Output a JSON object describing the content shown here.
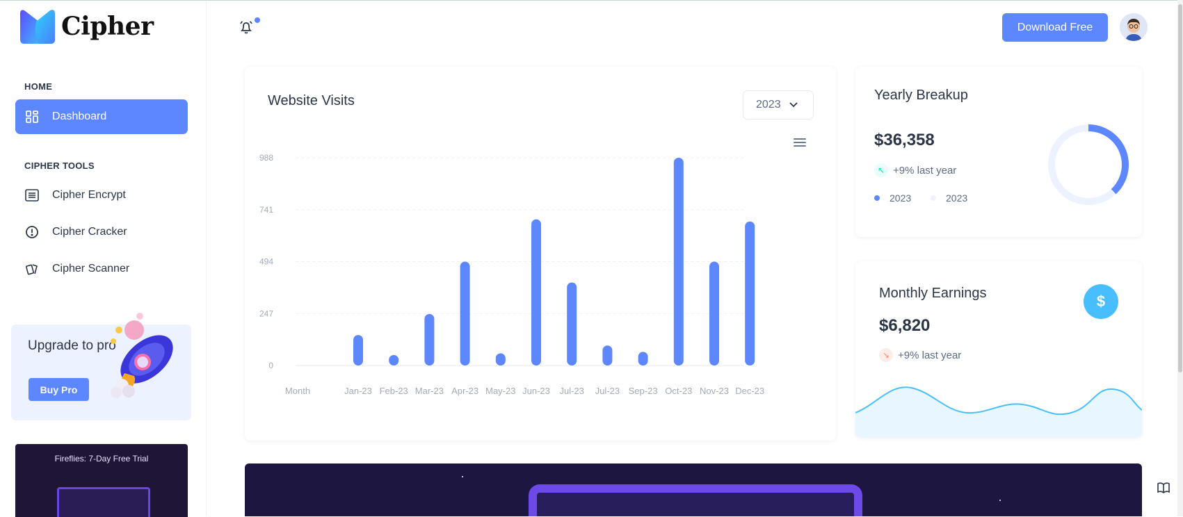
{
  "brand": {
    "name": "Cipher"
  },
  "sidebar": {
    "sections": [
      {
        "label": "HOME",
        "items": [
          {
            "label": "Dashboard",
            "icon": "grid-icon",
            "active": true
          }
        ]
      },
      {
        "label": "CIPHER TOOLS",
        "items": [
          {
            "label": "Cipher Encrypt",
            "icon": "list-icon"
          },
          {
            "label": "Cipher Cracker",
            "icon": "alert-circle-icon"
          },
          {
            "label": "Cipher Scanner",
            "icon": "cards-icon"
          }
        ]
      }
    ],
    "upgrade": {
      "title": "Upgrade to pro",
      "button": "Buy Pro"
    },
    "promo": {
      "text": "Fireflies: 7-Day Free Trial"
    }
  },
  "header": {
    "download_label": "Download Free",
    "notification_icon": "bell-icon"
  },
  "visits": {
    "title": "Website Visits",
    "year_selected": "2023",
    "menu_icon": "hamburger-icon"
  },
  "yearly": {
    "title": "Yearly Breakup",
    "amount": "$36,358",
    "trend": "+9% last year",
    "legend": [
      "2023",
      "2023"
    ],
    "donut_fraction": 0.38,
    "colors": {
      "primary": "#5d87ff",
      "light": "#ecf2ff"
    }
  },
  "monthly": {
    "title": "Monthly Earnings",
    "amount": "$6,820",
    "trend": "+9% last year",
    "icon": "dollar-icon",
    "colors": {
      "line": "#49beff",
      "trend_down": "#fa896b"
    }
  },
  "chart_data": {
    "type": "bar",
    "categories": [
      "Jan-23",
      "Feb-23",
      "Mar-23",
      "Apr-23",
      "May-23",
      "Jun-23",
      "Jul-23",
      "Jul-23",
      "Sep-23",
      "Oct-23",
      "Nov-23",
      "Dec-23"
    ],
    "x_first_label": "Month",
    "values": [
      145,
      50,
      245,
      494,
      58,
      695,
      395,
      95,
      65,
      988,
      494,
      685
    ],
    "yticks": [
      "0",
      "247",
      "494",
      "741",
      "988"
    ],
    "ylim": [
      0,
      988
    ],
    "color": "#5d87ff",
    "grid": true
  }
}
